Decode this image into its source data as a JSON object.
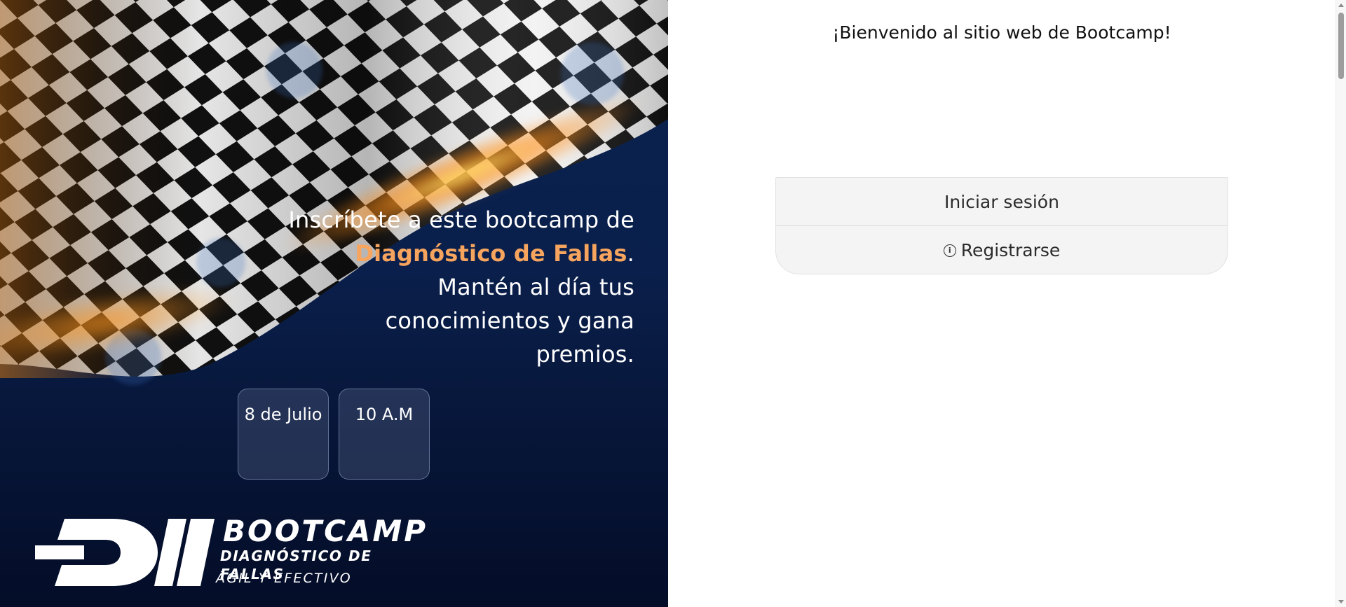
{
  "hero": {
    "headline_part1": "Inscríbete a este bootcamp de ",
    "headline_highlight": "Diagnóstico de Fallas",
    "headline_part2": ". Mantén al día tus conocimientos y gana premios.",
    "date_label": "8 de Julio",
    "time_label": "10 A.M",
    "highlight_color": "#f7a55e",
    "logo": {
      "title": "BOOTCAMP",
      "subtitle": "DIAGNÓSTICO DE FALLAS",
      "tagline": "ÁGIL Y EFECTIVO"
    }
  },
  "main": {
    "welcome": "¡Bienvenido al sitio web de Bootcamp!",
    "login_label": "Iniciar sesión",
    "register_label": "Registrarse",
    "register_icon": "info-icon"
  }
}
